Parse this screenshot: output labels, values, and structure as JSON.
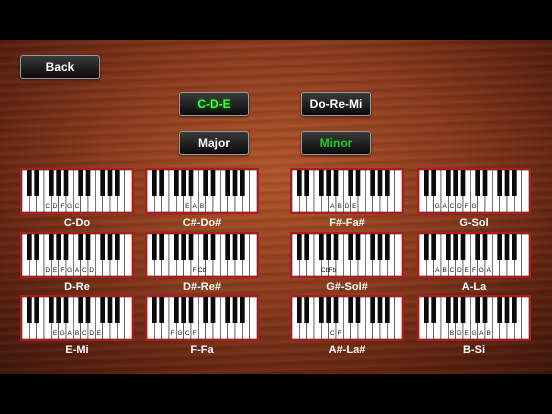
{
  "toolbar": {
    "back_label": "Back"
  },
  "notation": {
    "letters_label": "C-D-E",
    "solfege_label": "Do-Re-Mi"
  },
  "mode": {
    "major_label": "Major",
    "minor_label": "Minor"
  },
  "colors": {
    "active": "#39ff3a",
    "card_border": "#b3181c"
  },
  "chords": [
    {
      "name": "C-Do",
      "labels": [
        "C",
        "D",
        "F",
        "G",
        "C"
      ]
    },
    {
      "name": "C#-Do#",
      "labels": [
        "E",
        "A",
        "B"
      ]
    },
    {
      "name": "F#-Fa#",
      "labels": [
        "A",
        "B",
        "D",
        "E"
      ]
    },
    {
      "name": "G-Sol",
      "labels": [
        "G",
        "A",
        "C",
        "D",
        "F",
        "G"
      ]
    },
    {
      "name": "D-Re",
      "labels": [
        "D",
        "E",
        "F",
        "G",
        "A",
        "C",
        "D"
      ]
    },
    {
      "name": "D#-Re#",
      "labels": [
        "F",
        "Cb"
      ]
    },
    {
      "name": "G#-Sol#",
      "labels": [
        "Cb",
        "Fb"
      ]
    },
    {
      "name": "A-La",
      "labels": [
        "A",
        "B",
        "C",
        "D",
        "E",
        "F",
        "G",
        "A"
      ]
    },
    {
      "name": "E-Mi",
      "labels": [
        "E",
        "G",
        "A",
        "B",
        "C",
        "D",
        "E"
      ]
    },
    {
      "name": "F-Fa",
      "labels": [
        "F",
        "G",
        "C",
        "F"
      ]
    },
    {
      "name": "A#-La#",
      "labels": [
        "C",
        "F"
      ]
    },
    {
      "name": "B-Si",
      "labels": [
        "B",
        "D",
        "E",
        "G",
        "A",
        "B"
      ]
    }
  ]
}
